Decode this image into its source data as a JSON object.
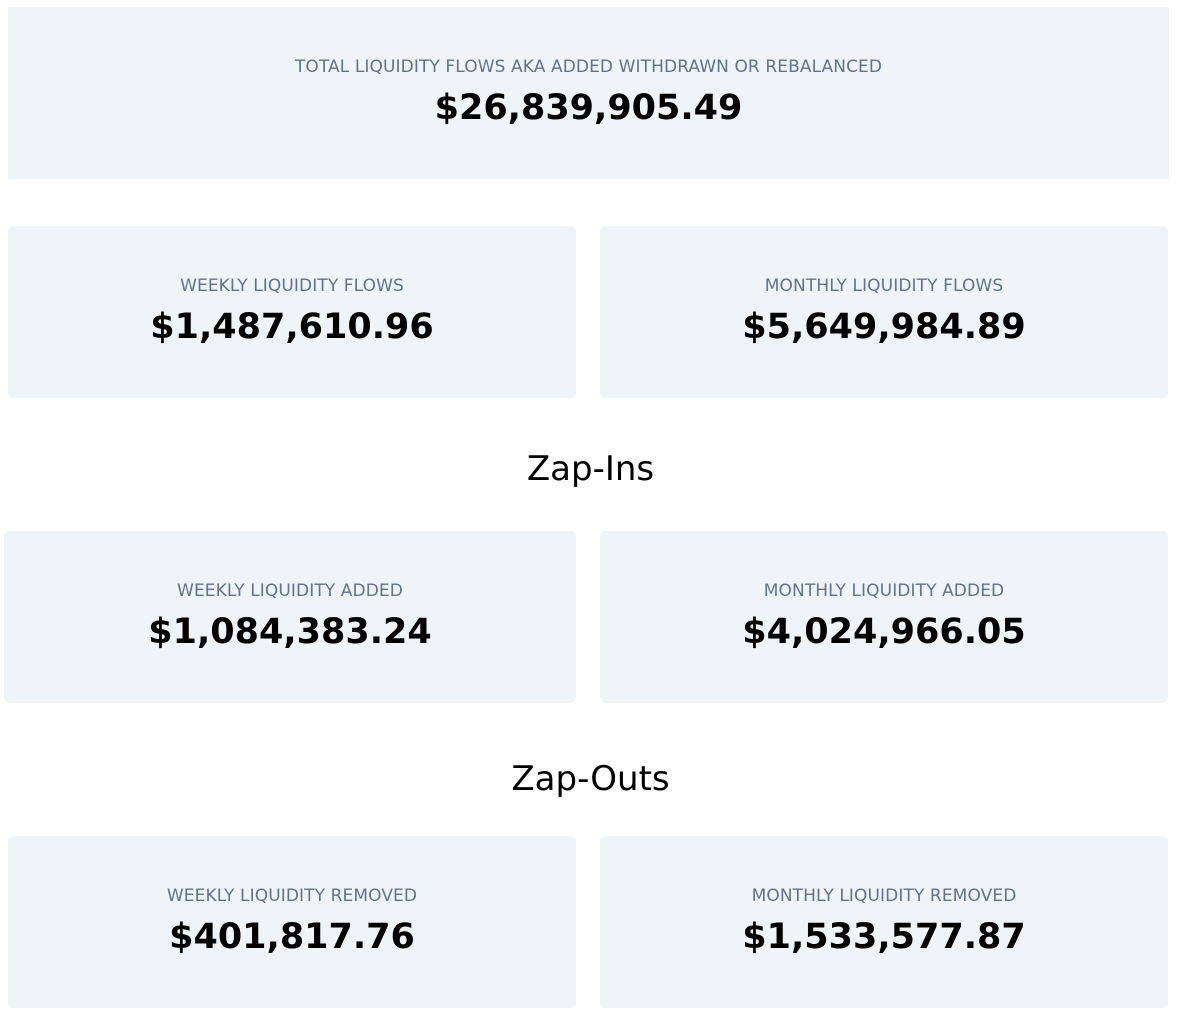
{
  "total": {
    "label": "TOTAL LIQUIDITY FLOWS AKA ADDED WITHDRAWN OR REBALANCED",
    "value": "$26,839,905.49"
  },
  "flows": {
    "weekly": {
      "label": "WEEKLY LIQUIDITY FLOWS",
      "value": "$1,487,610.96"
    },
    "monthly": {
      "label": "MONTHLY LIQUIDITY FLOWS",
      "value": "$5,649,984.89"
    }
  },
  "zap_ins": {
    "title": "Zap-Ins",
    "weekly": {
      "label": "WEEKLY LIQUIDITY ADDED",
      "value": "$1,084,383.24"
    },
    "monthly": {
      "label": "MONTHLY LIQUIDITY ADDED",
      "value": "$4,024,966.05"
    }
  },
  "zap_outs": {
    "title": "Zap-Outs",
    "weekly": {
      "label": "WEEKLY LIQUIDITY REMOVED",
      "value": "$401,817.76"
    },
    "monthly": {
      "label": "MONTHLY LIQUIDITY REMOVED",
      "value": "$1,533,577.87"
    }
  },
  "colors": {
    "card_background": "#eff4f8",
    "label_text": "#5f7391",
    "value_text": "#000000"
  }
}
